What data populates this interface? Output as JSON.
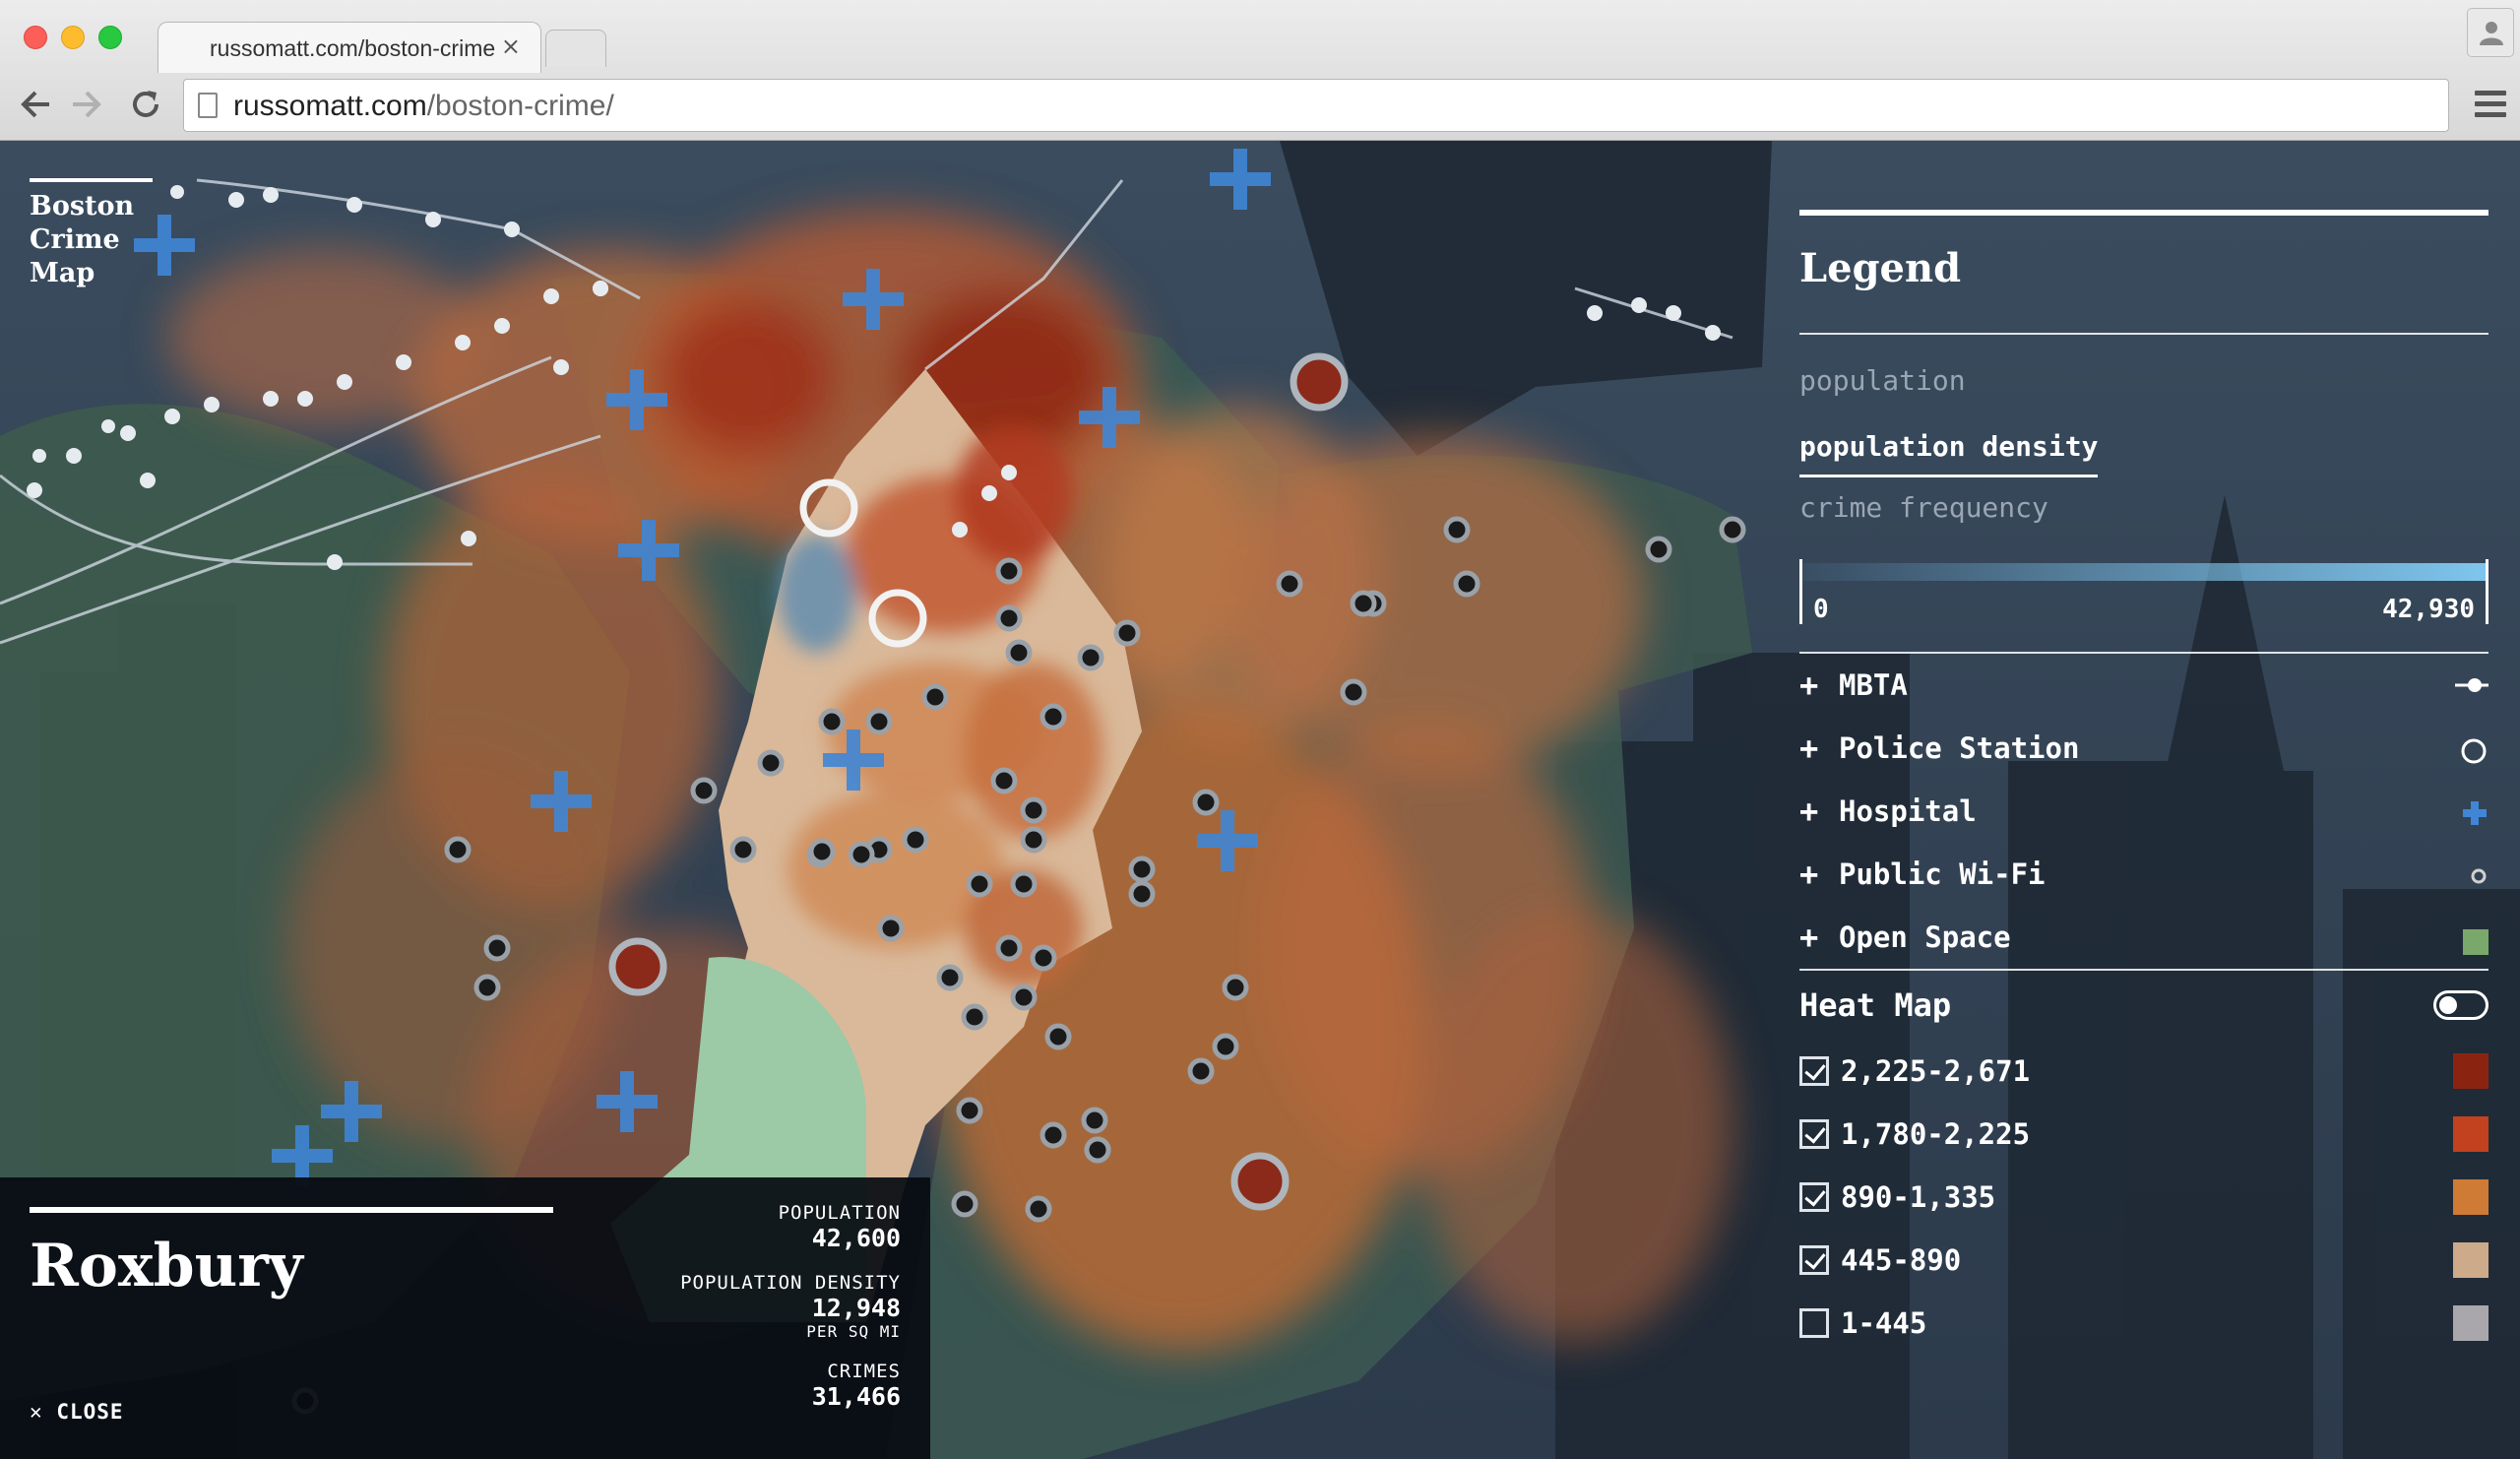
{
  "browser": {
    "tab_title": "russomatt.com/boston-crime/",
    "tab_close": "×",
    "url_host": "russomatt.com",
    "url_path": "/boston-crime/"
  },
  "app": {
    "title_line1": "Boston",
    "title_line2": "Crime",
    "title_line3": "Map"
  },
  "legend": {
    "title": "Legend",
    "options": [
      "population",
      "population density",
      "crime frequency"
    ],
    "active_option": "population density",
    "scale_min": "0",
    "scale_max": "42,930",
    "layers": [
      {
        "label": "MBTA",
        "icon": "mbta-line-icon"
      },
      {
        "label": "Police Station",
        "icon": "ring-icon"
      },
      {
        "label": "Hospital",
        "icon": "blue-cross-icon"
      },
      {
        "label": "Public Wi-Fi",
        "icon": "small-circle-icon"
      },
      {
        "label": "Open Space",
        "icon": "green-square-icon"
      }
    ],
    "heat_map": {
      "label": "Heat Map",
      "enabled": false,
      "bins": [
        {
          "label": "2,225-2,671",
          "checked": true,
          "color": "#8a2411"
        },
        {
          "label": "1,780-2,225",
          "checked": true,
          "color": "#c2411f"
        },
        {
          "label": "890-1,335",
          "checked": true,
          "color": "#cf7a35"
        },
        {
          "label": "445-890",
          "checked": true,
          "color": "#cdaa8a"
        },
        {
          "label": "1-445",
          "checked": false,
          "color": "#a9a7ab"
        }
      ]
    },
    "colors": {
      "hospital": "#3f86d6",
      "open_space": "#7aa86b"
    }
  },
  "neighborhood": {
    "name": "Roxbury",
    "close_label": "CLOSE",
    "population_label": "POPULATION",
    "population": "42,600",
    "density_label": "POPULATION DENSITY",
    "density": "12,948",
    "density_unit": "PER SQ MI",
    "crimes_label": "CRIMES",
    "crimes": "31,466"
  }
}
